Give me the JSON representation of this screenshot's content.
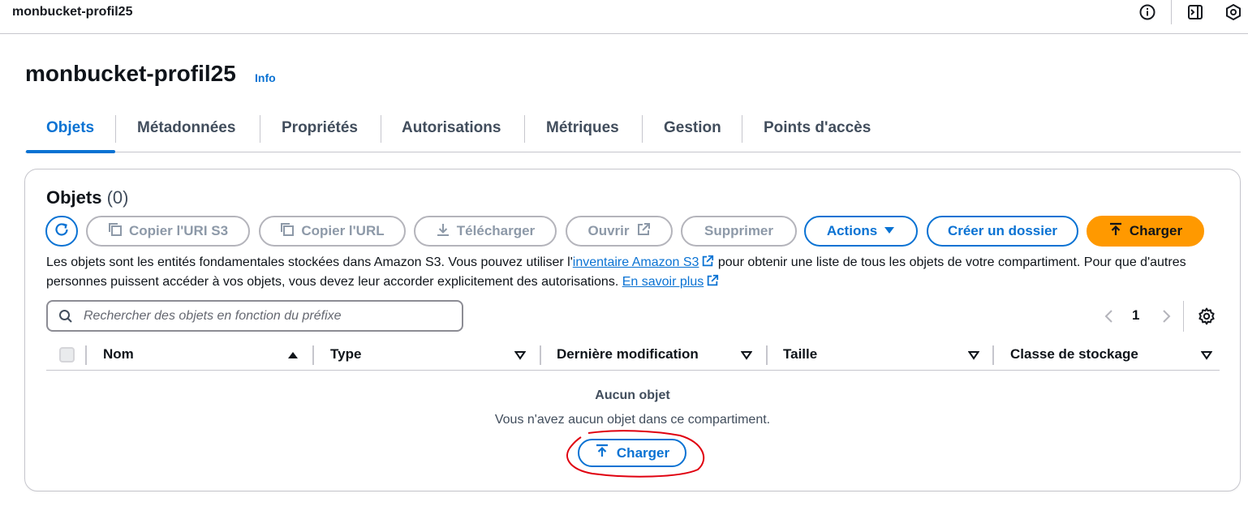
{
  "topbar": {
    "breadcrumb": "monbucket-profil25",
    "icons": [
      "info-circle-icon",
      "panel-toggle-icon",
      "shield-hexagon-icon"
    ]
  },
  "header": {
    "title": "monbucket-profil25",
    "info_label": "Info"
  },
  "tabs": [
    {
      "label": "Objets",
      "active": true
    },
    {
      "label": "Métadonnées",
      "active": false
    },
    {
      "label": "Propriétés",
      "active": false
    },
    {
      "label": "Autorisations",
      "active": false
    },
    {
      "label": "Métriques",
      "active": false
    },
    {
      "label": "Gestion",
      "active": false
    },
    {
      "label": "Points d'accès",
      "active": false
    }
  ],
  "objects": {
    "title": "Objets",
    "count": "(0)",
    "toolbar": {
      "copy_uri": "Copier l'URI S3",
      "copy_url": "Copier l'URL",
      "download": "Télécharger",
      "open": "Ouvrir",
      "delete": "Supprimer",
      "actions": "Actions",
      "create_folder": "Créer un dossier",
      "upload": "Charger"
    },
    "description": {
      "part1": "Les objets sont les entités fondamentales stockées dans Amazon S3. Vous pouvez utiliser l'",
      "inventory_link": "inventaire Amazon S3",
      "part2": " pour obtenir une liste de tous les objets de votre compartiment. Pour que d'autres personnes puissent accéder à vos objets, vous devez leur accorder explicitement des autorisations. ",
      "learn_more": "En savoir plus"
    },
    "search": {
      "placeholder": "Rechercher des objets en fonction du préfixe",
      "value": ""
    },
    "pagination": {
      "current_page": "1"
    },
    "columns": [
      "Nom",
      "Type",
      "Dernière modification",
      "Taille",
      "Classe de stockage"
    ],
    "empty": {
      "title": "Aucun objet",
      "text": "Vous n'avez aucun objet dans ce compartiment.",
      "button": "Charger"
    }
  },
  "colors": {
    "accent": "#0972d3",
    "upload_button": "#ff9900",
    "annotation": "#e0000f",
    "disabled": "#8d99a8"
  }
}
